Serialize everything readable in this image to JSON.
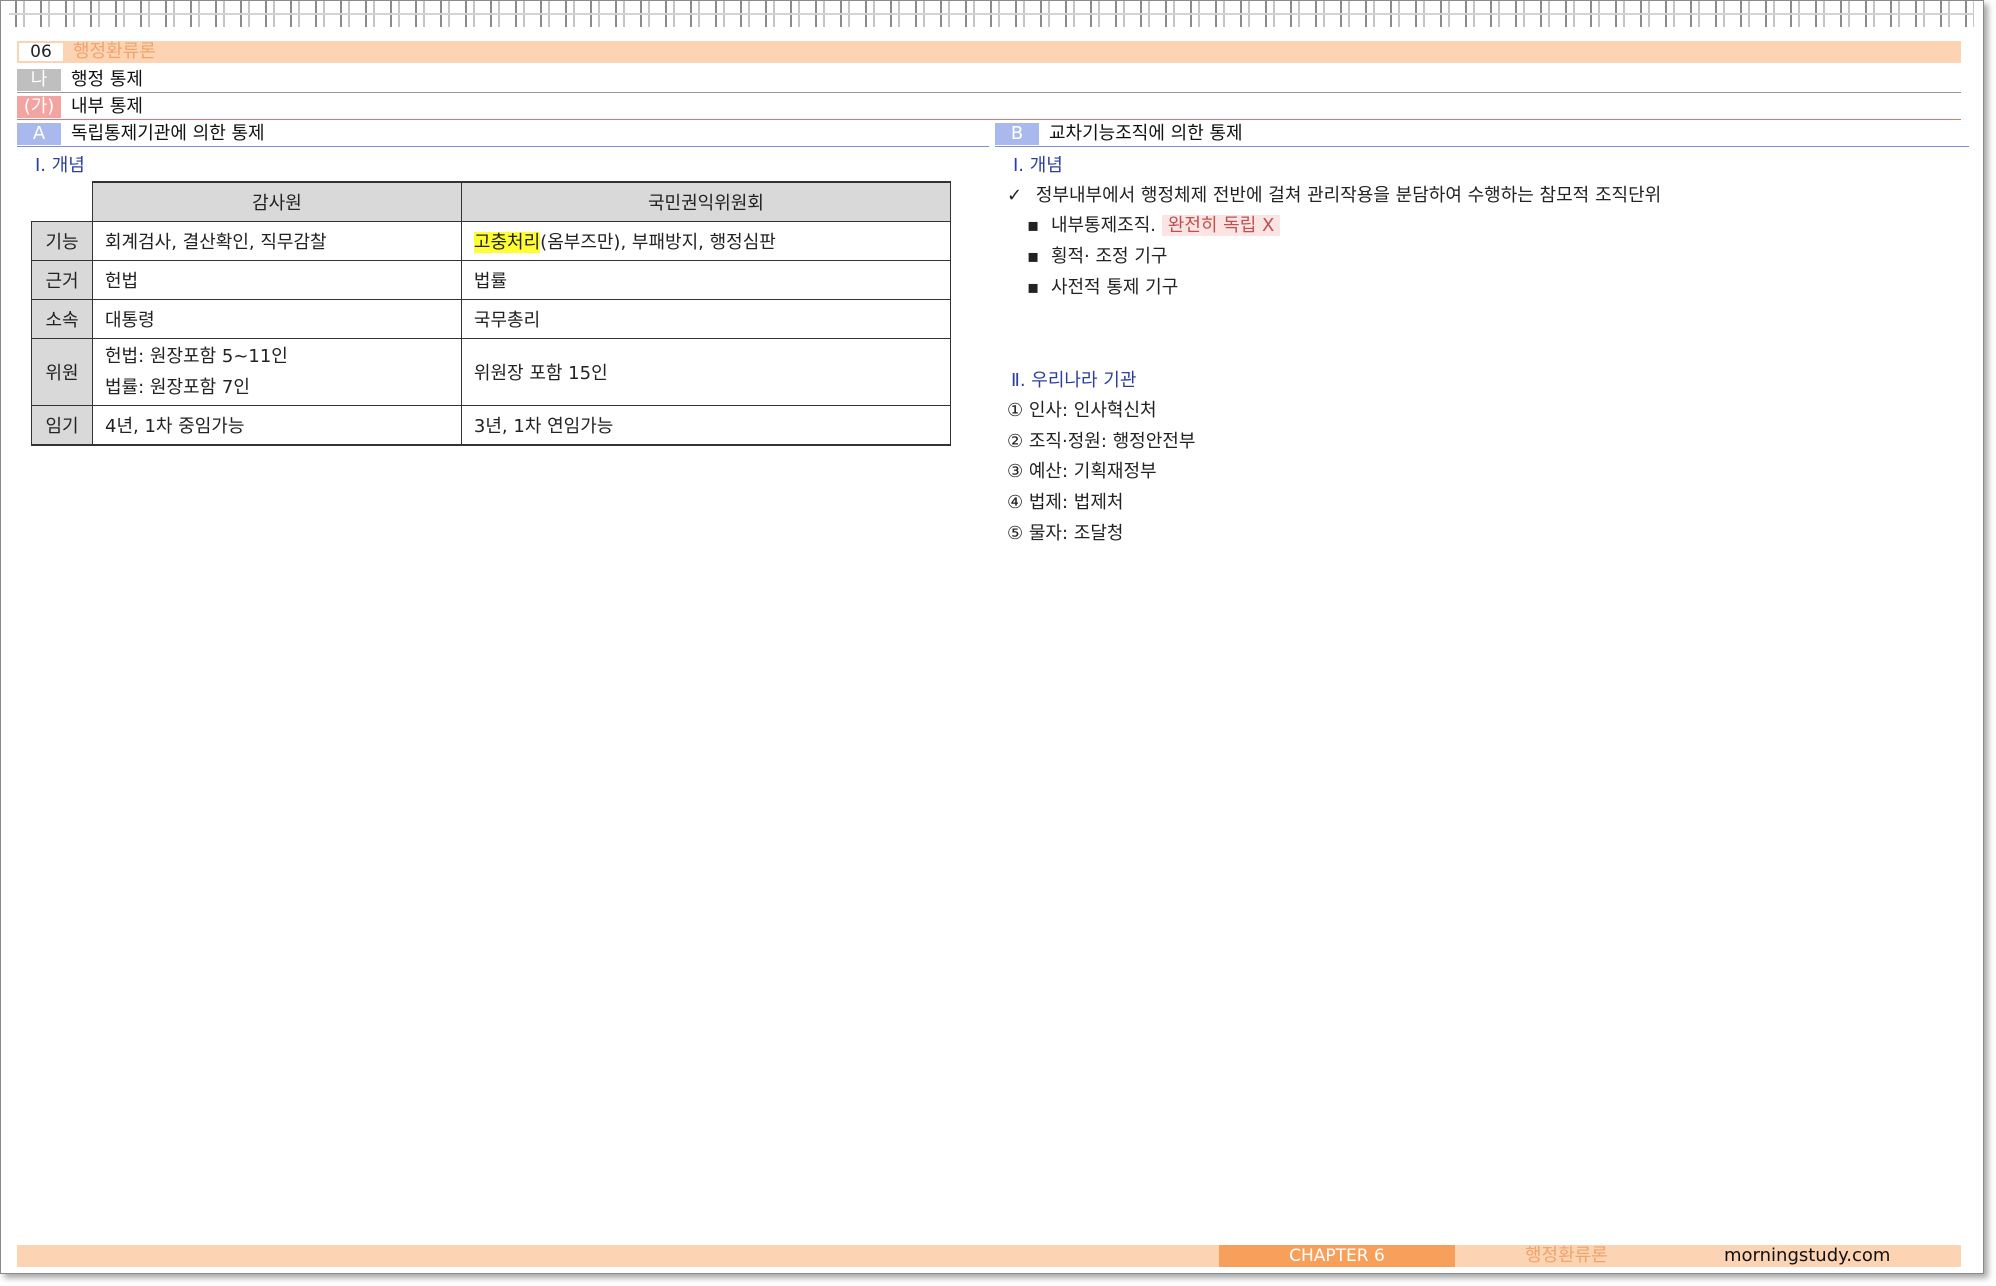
{
  "header": {
    "num": "06",
    "title": "행정환류론"
  },
  "level1": {
    "tag": "나",
    "title": "행정 통제"
  },
  "level2": {
    "tag": "(가)",
    "title": "내부 통제"
  },
  "left": {
    "tag": "A",
    "title": "독립통제기관에 의한 통제",
    "concept": "Ⅰ. 개념",
    "table": {
      "headers": [
        "감사원",
        "국민권익위원회"
      ],
      "rows": [
        {
          "key": "기능",
          "a": "회계검사, 결산확인, 직무감찰",
          "b_hl": "고충처리",
          "b": "(옴부즈만), 부패방지, 행정심판"
        },
        {
          "key": "근거",
          "a": "헌법",
          "b": "법률"
        },
        {
          "key": "소속",
          "a": "대통령",
          "b": "국무총리"
        },
        {
          "key": "위원",
          "a1": "헌법: 원장포함 5~11인",
          "a2": "법률: 원장포함 7인",
          "b": "위원장 포함 15인"
        },
        {
          "key": "임기",
          "a": "4년, 1차 중임가능",
          "b": "3년, 1차 연임가능"
        }
      ]
    }
  },
  "right": {
    "tag": "B",
    "title": "교차기능조직에 의한 통제",
    "concept": "Ⅰ. 개념",
    "check": "✓",
    "main_text": "정부내부에서 행정체제 전반에 걸쳐 관리작용을 분담하여 수행하는 참모적 조직단위",
    "bullets": [
      {
        "text": "내부통제조직.",
        "hl": "완전히 독립 X"
      },
      {
        "text": "횡적· 조정 기구"
      },
      {
        "text": "사전적 통제 기구"
      }
    ],
    "section2": "Ⅱ. 우리나라 기관",
    "agencies": [
      "① 인사: 인사혁신처",
      "② 조직·정원: 행정안전부",
      "③ 예산: 기획재정부",
      "④ 법제: 법제처",
      "⑤ 물자: 조달청"
    ]
  },
  "footer": {
    "chapter": "CHAPTER 6",
    "subject": "행정환류론",
    "site": "morningstudy.com"
  },
  "colors": {
    "orange_light": "#fcd4b4",
    "orange": "#f6a05b",
    "tag_gray": "#bfbfbf",
    "tag_pink": "#f4a3a3",
    "tag_blue": "#a9b9ee",
    "highlight": "#ffff33"
  }
}
